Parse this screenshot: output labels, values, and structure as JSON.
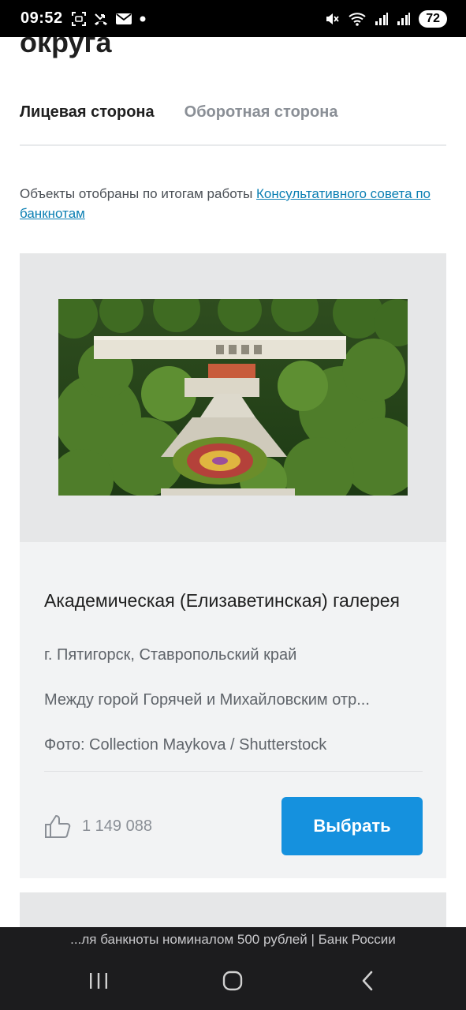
{
  "status_bar": {
    "time": "09:52",
    "battery": "72",
    "icons": [
      "screenshot-icon",
      "phone-missed-icon",
      "mail-icon",
      "dot-icon",
      "mute-icon",
      "wifi-icon",
      "signal-icon",
      "signal-icon"
    ]
  },
  "page": {
    "title": "округа"
  },
  "tabs": [
    {
      "label": "Лицевая сторона",
      "active": true
    },
    {
      "label": "Оборотная сторона",
      "active": false
    }
  ],
  "notice": {
    "text": "Объекты отобраны по итогам работы ",
    "link": "Консультативного совета по банкнотам"
  },
  "card": {
    "title": "Академическая (Елизаветинская) галерея",
    "location": "г. Пятигорск, Ставропольский край",
    "description": "Между горой Горячей и Михайловским отр...",
    "credit": "Фото: Collection Maykova / Shutterstock",
    "likes": "1 149 088",
    "select_label": "Выбрать"
  },
  "browser": {
    "caption": "...ля банкноты номиналом 500 рублей | Банк России"
  },
  "colors": {
    "accent": "#1591de",
    "link": "#0b7fb3",
    "card_bg": "#f2f3f4"
  }
}
